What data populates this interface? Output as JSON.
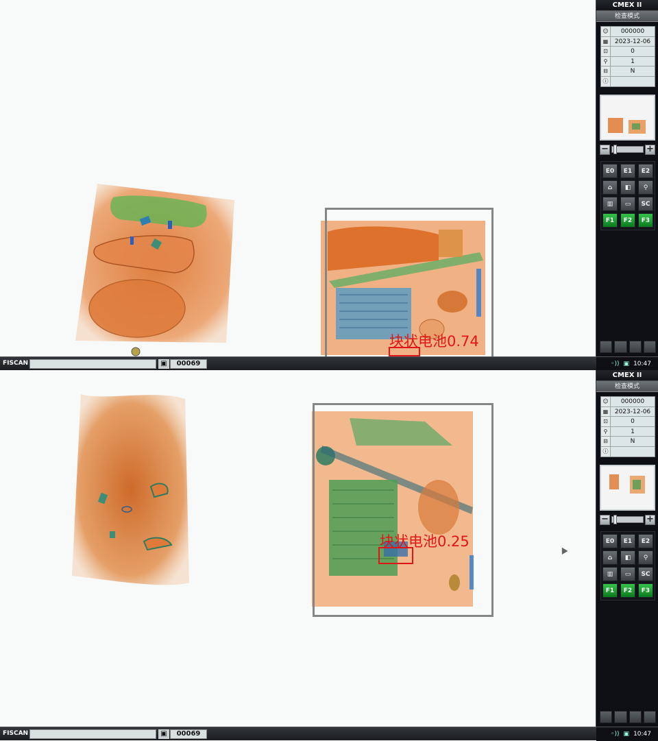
{
  "app": {
    "title": "CMEX II",
    "mode": "检查模式"
  },
  "info": [
    {
      "icon": "operator-icon",
      "glyph": "☺",
      "value": "000000"
    },
    {
      "icon": "calendar-icon",
      "glyph": "▦",
      "value": "2023-12-06"
    },
    {
      "icon": "counter-icon",
      "glyph": "⊡",
      "value": "0"
    },
    {
      "icon": "magnifier-icon",
      "glyph": "⚲",
      "value": "1"
    },
    {
      "icon": "conveyor-icon",
      "glyph": "⊟",
      "value": "N"
    },
    {
      "icon": "info-icon",
      "glyph": "ⓘ",
      "value": ""
    }
  ],
  "buttons": [
    {
      "name": "e0-button",
      "label": "E0"
    },
    {
      "name": "e1-button",
      "label": "E1"
    },
    {
      "name": "e2-button",
      "label": "E2"
    },
    {
      "name": "home-button",
      "label": "⌂"
    },
    {
      "name": "contrast-button",
      "label": "◧"
    },
    {
      "name": "zoom-button",
      "label": "⚲"
    },
    {
      "name": "split-view-button",
      "label": "▥"
    },
    {
      "name": "image-button",
      "label": "▭"
    },
    {
      "name": "sc-button",
      "label": "SC"
    },
    {
      "name": "f1-button",
      "label": "F1"
    },
    {
      "name": "f2-button",
      "label": "F2"
    },
    {
      "name": "f3-button",
      "label": "F3"
    }
  ],
  "statusbar": {
    "brand": "FISCAN",
    "bag_count": "00069",
    "time": "10:47"
  },
  "screens": [
    {
      "alarm_label": "块状电池0.74"
    },
    {
      "alarm_label": "块状电池0.25"
    }
  ]
}
